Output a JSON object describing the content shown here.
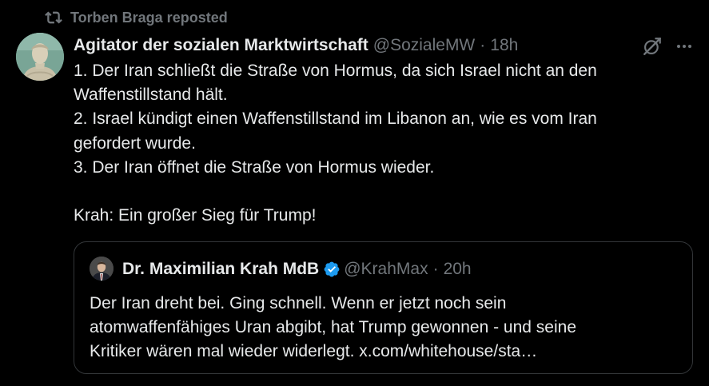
{
  "repost": {
    "icon": "repost-icon",
    "text": "Torben Braga reposted"
  },
  "post": {
    "avatar_icon": "statue-bust-avatar",
    "author_name": "Agitator der sozialen Marktwirtschaft",
    "handle": "@SozialeMW",
    "separator": "·",
    "time": "18h",
    "lines": [
      "1. Der Iran schließt die Straße von Hormus, da sich Israel nicht an den",
      "Waffenstillstand hält.",
      "2. Israel kündigt einen Waffenstillstand im Libanon an, wie es vom Iran",
      "gefordert wurde.",
      "3. Der Iran öffnet die Straße von Hormus wieder.",
      "",
      "Krah: Ein großer Sieg für Trump!"
    ]
  },
  "quote": {
    "avatar_icon": "portrait-avatar",
    "author_name": "Dr. Maximilian Krah MdB",
    "verified_icon": "verified-badge-icon",
    "handle": "@KrahMax",
    "separator": "·",
    "time": "20h",
    "lines": [
      "Der Iran dreht bei. Ging schnell. Wenn er jetzt noch sein",
      "atomwaffenfähiges Uran abgibt, hat Trump gewonnen - und seine",
      "Kritiker wären mal wieder widerlegt. x.com/whitehouse/sta…"
    ]
  },
  "actions": {
    "grok_icon": "grok-icon",
    "more_icon": "more-options-icon"
  },
  "colors": {
    "background": "#000000",
    "text_primary": "#e7e9ea",
    "text_muted": "#71767b",
    "border": "#333639",
    "verified": "#1d9bf0"
  }
}
